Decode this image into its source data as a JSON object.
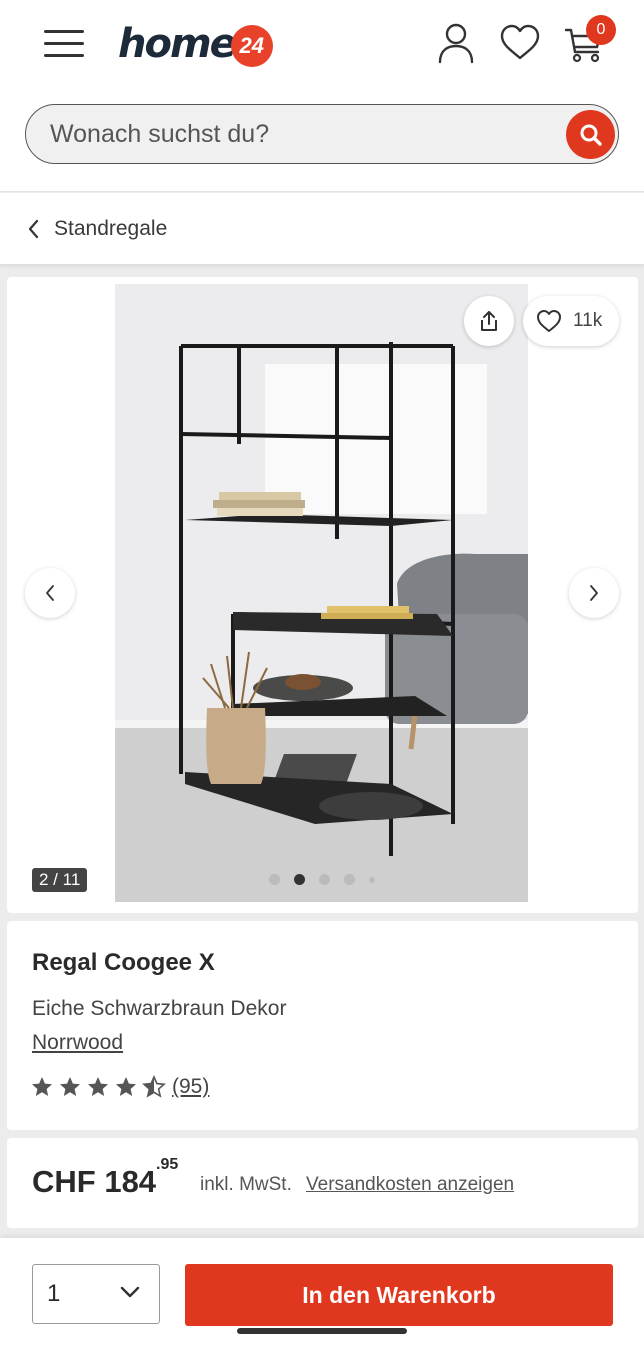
{
  "header": {
    "logo_text": "home",
    "logo_badge": "24",
    "cart_count": "0"
  },
  "search": {
    "placeholder": "Wonach suchst du?"
  },
  "breadcrumb": {
    "label": "Standregale"
  },
  "gallery": {
    "favorites_count": "11k",
    "counter": "2 / 11",
    "active_index": 2,
    "total_images": 11
  },
  "product": {
    "name": "Regal Coogee X",
    "variant": "Eiche Schwarzbraun Dekor",
    "brand": "Norrwood",
    "rating_stars": 4.5,
    "rating_count": "(95)"
  },
  "price": {
    "currency_main": "CHF 184",
    "cents": "95",
    "vat_text": "inkl. MwSt.",
    "shipping_link": "Versandkosten anzeigen"
  },
  "bottom_bar": {
    "quantity": "1",
    "add_to_cart": "In den Warenkorb"
  },
  "colors": {
    "accent": "#e0371f",
    "text": "#2b2b2b",
    "background": "#ececec"
  }
}
